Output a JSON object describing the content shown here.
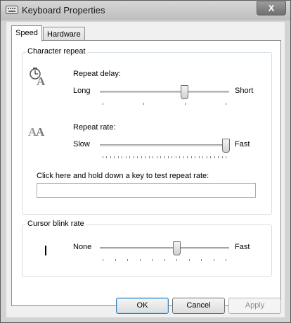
{
  "window": {
    "title": "Keyboard Properties",
    "close_glyph": "X"
  },
  "tabs": [
    {
      "label": "Speed",
      "active": true
    },
    {
      "label": "Hardware",
      "active": false
    }
  ],
  "character_repeat": {
    "group_title": "Character repeat",
    "repeat_delay": {
      "label": "Repeat delay:",
      "min_label": "Long",
      "max_label": "Short",
      "ticks": 4,
      "value_fraction": 0.66
    },
    "repeat_rate": {
      "label": "Repeat rate:",
      "min_label": "Slow",
      "max_label": "Fast",
      "ticks": 33,
      "value_fraction": 1.0
    },
    "test_label": "Click here and hold down a key to test repeat rate:",
    "test_value": ""
  },
  "cursor_blink": {
    "group_title": "Cursor blink rate",
    "min_label": "None",
    "max_label": "Fast",
    "ticks": 11,
    "value_fraction": 0.6
  },
  "buttons": {
    "ok": "OK",
    "cancel": "Cancel",
    "apply": "Apply"
  }
}
